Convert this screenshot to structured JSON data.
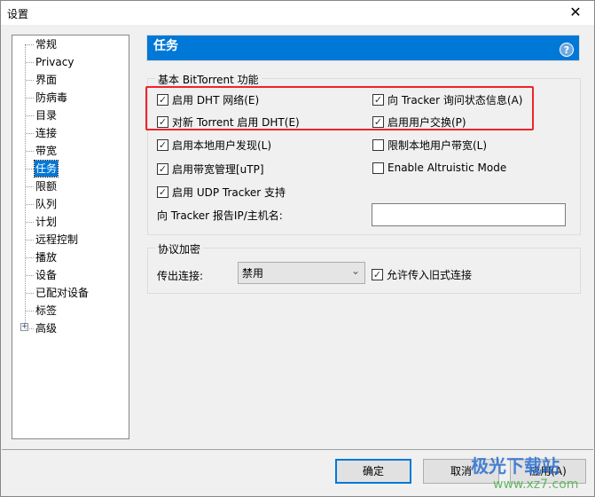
{
  "window": {
    "title": "设置",
    "close_icon": "close-icon"
  },
  "tree": {
    "items": [
      "常规",
      "Privacy",
      "界面",
      "防病毒",
      "目录",
      "连接",
      "带宽",
      "任务",
      "限额",
      "队列",
      "计划",
      "远程控制",
      "播放",
      "设备",
      "已配对设备",
      "标签",
      "高级"
    ],
    "selected": "任务"
  },
  "header": {
    "title": "任务",
    "help": "?"
  },
  "basic": {
    "legend": "基本 BitTorrent 功能",
    "checkboxes": [
      {
        "label": "启用 DHT 网络(E)",
        "checked": true
      },
      {
        "label": "向 Tracker 询问状态信息(A)",
        "checked": true
      },
      {
        "label": "对新 Torrent 启用 DHT(E)",
        "checked": true
      },
      {
        "label": "启用用户交换(P)",
        "checked": true
      },
      {
        "label": "启用本地用户发现(L)",
        "checked": true
      },
      {
        "label": "限制本地用户带宽(L)",
        "checked": false
      },
      {
        "label": "启用带宽管理[uTP]",
        "checked": true
      },
      {
        "label": "Enable Altruistic Mode",
        "checked": false
      },
      {
        "label": "启用 UDP Tracker 支持",
        "checked": true
      }
    ],
    "ip_label": "向 Tracker 报告IP/主机名:",
    "ip_value": ""
  },
  "encryption": {
    "legend": "协议加密",
    "outgoing_label": "传出连接:",
    "outgoing_value": "禁用",
    "allow_legacy": {
      "label": "允许传入旧式连接",
      "checked": true
    }
  },
  "buttons": {
    "ok": "确定",
    "cancel": "取消",
    "apply": "应用(A)"
  },
  "watermark": {
    "text": "极光下载站",
    "url": "www.xz7.com"
  },
  "colors": {
    "accent": "#0078d7",
    "highlight": "#f0232a"
  }
}
